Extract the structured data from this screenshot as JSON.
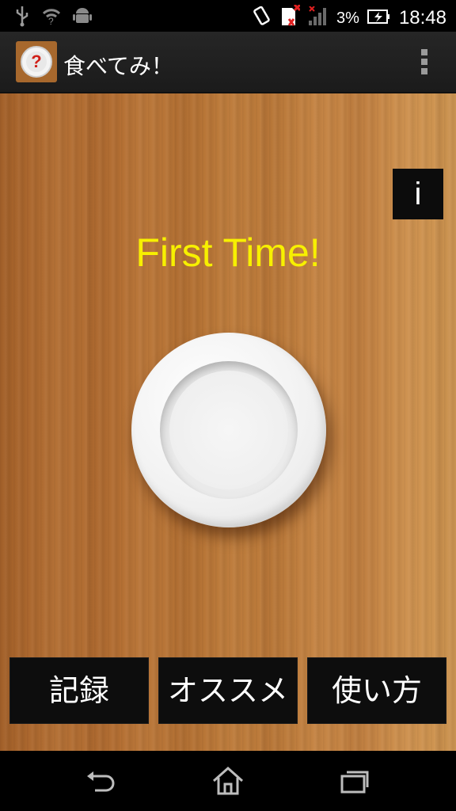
{
  "status_bar": {
    "battery_percent": "3%",
    "time": "18:48",
    "icons": [
      "usb-icon",
      "wifi-icon",
      "android-icon",
      "vibrate-icon",
      "sim-error-icon",
      "signal-icon",
      "battery-charging-icon"
    ]
  },
  "action_bar": {
    "app_title": "食べてみ！",
    "app_icon": "question-plate-icon",
    "overflow_icon": "overflow-menu-icon"
  },
  "main": {
    "info_label": "i",
    "status_message": "First Time!",
    "plate_icon": "plate-icon"
  },
  "buttons": {
    "records": "記録",
    "recommend": "オススメ",
    "how_to": "使い方"
  },
  "nav_bar": {
    "icons": [
      "back-icon",
      "home-icon",
      "recent-apps-icon"
    ]
  },
  "colors": {
    "status_text": "#f7f000",
    "button_bg": "#0d0d0d",
    "wood": "#b46f33"
  }
}
